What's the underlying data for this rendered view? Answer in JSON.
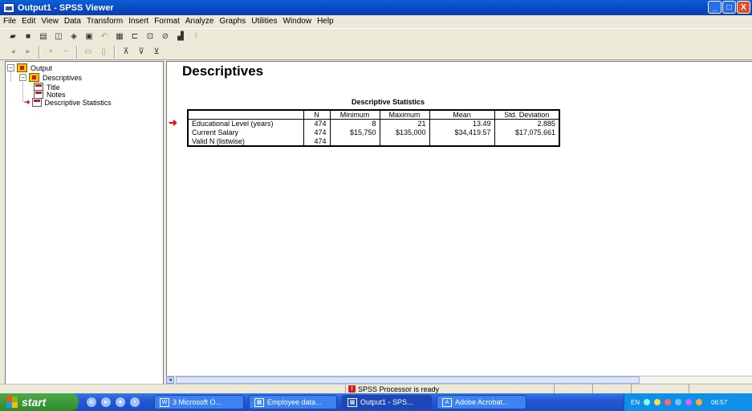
{
  "window": {
    "title": "Output1 - SPSS Viewer",
    "min": "_",
    "max": "□",
    "close": "X"
  },
  "menu": [
    "File",
    "Edit",
    "View",
    "Data",
    "Transform",
    "Insert",
    "Format",
    "Analyze",
    "Graphs",
    "Utilities",
    "Window",
    "Help"
  ],
  "tree": {
    "root": "Output",
    "folder": "Descriptives",
    "items": [
      "Title",
      "Notes",
      "Descriptive Statistics"
    ]
  },
  "output": {
    "heading": "Descriptives",
    "table_title": "Descriptive Statistics",
    "columns": [
      "",
      "N",
      "Minimum",
      "Maximum",
      "Mean",
      "Std. Deviation"
    ],
    "rows": [
      [
        "Educational Level (years)",
        "474",
        "8",
        "21",
        "13.49",
        "2.885"
      ],
      [
        "Current Salary",
        "474",
        "$15,750",
        "$135,000",
        "$34,419.57",
        "$17,075.661"
      ],
      [
        "Valid N (listwise)",
        "474",
        "",
        "",
        "",
        ""
      ]
    ]
  },
  "status": {
    "text": "SPSS Processor  is ready"
  },
  "taskbar": {
    "start": "start",
    "tasks": [
      "3 Microsoft O...",
      "Employee data...",
      "Output1 - SPS...",
      "Adobe Acrobat..."
    ],
    "lang": "EN",
    "clock": "06:57"
  }
}
